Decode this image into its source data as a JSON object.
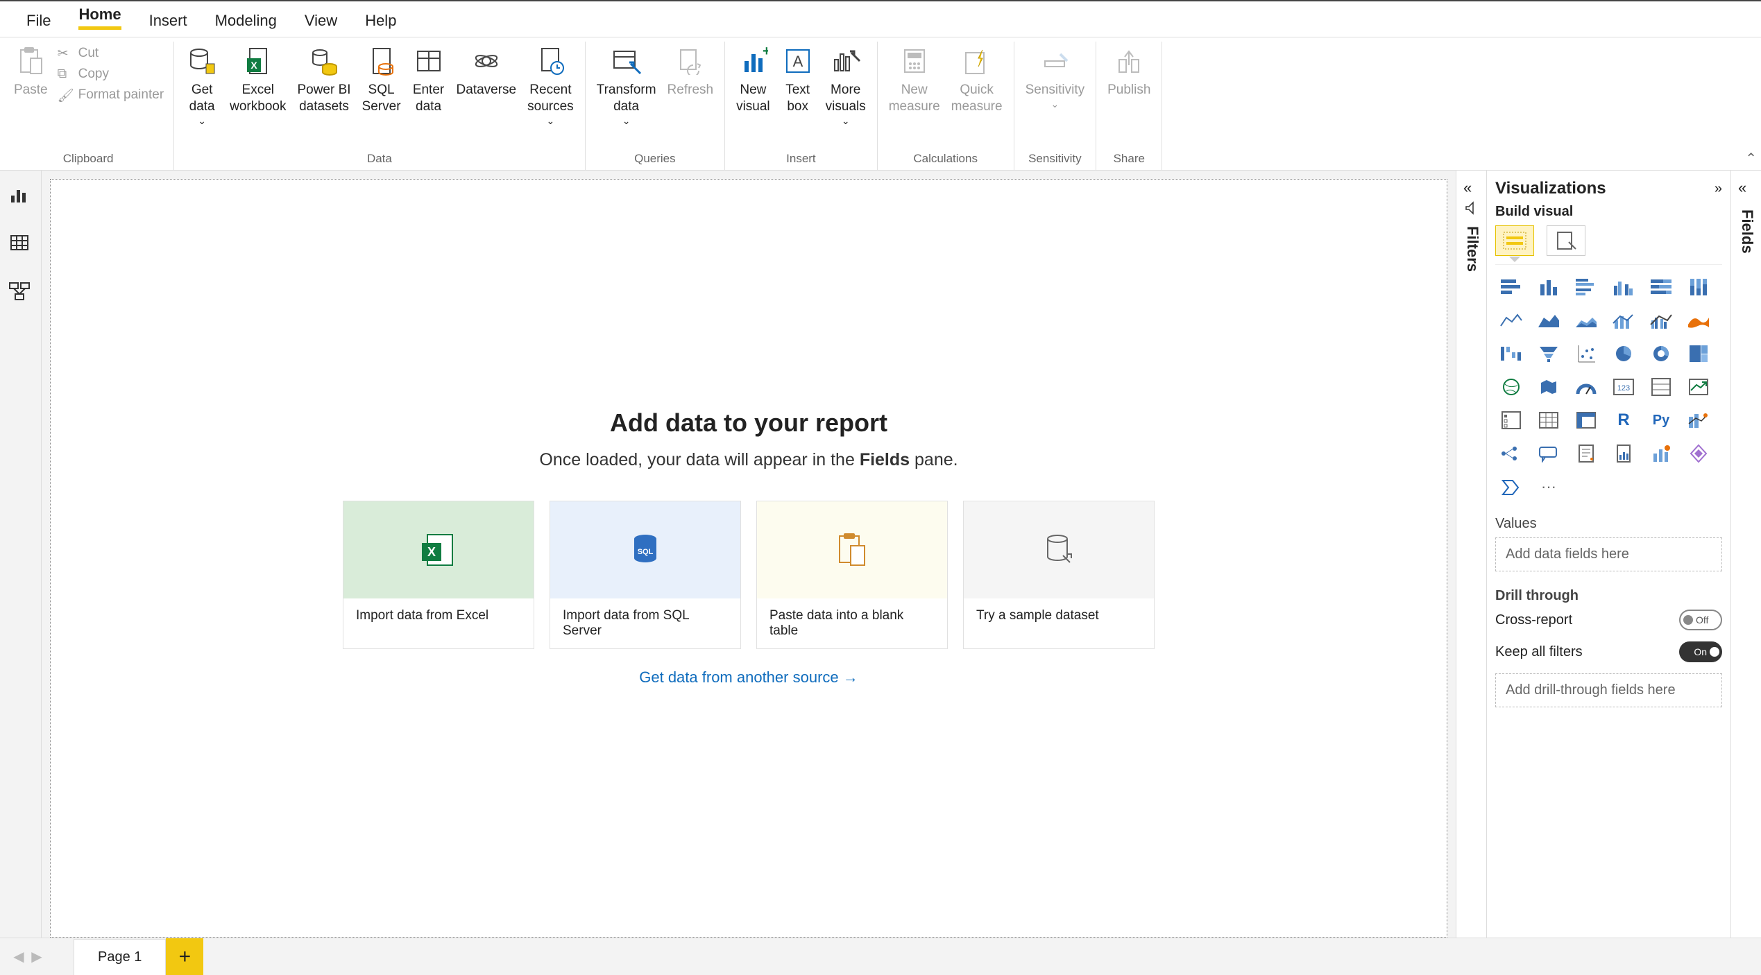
{
  "menu": {
    "file": "File",
    "home": "Home",
    "insert": "Insert",
    "modeling": "Modeling",
    "view": "View",
    "help": "Help"
  },
  "clipboard": {
    "group": "Clipboard",
    "paste": "Paste",
    "cut": "Cut",
    "copy": "Copy",
    "format_painter": "Format painter"
  },
  "data_group": {
    "group": "Data",
    "get_data": "Get\ndata",
    "excel": "Excel\nworkbook",
    "pbi": "Power BI\ndatasets",
    "sql": "SQL\nServer",
    "enter": "Enter\ndata",
    "dataverse": "Dataverse",
    "recent": "Recent\nsources"
  },
  "queries": {
    "group": "Queries",
    "transform": "Transform\ndata",
    "refresh": "Refresh"
  },
  "insert_group": {
    "group": "Insert",
    "new_visual": "New\nvisual",
    "text_box": "Text\nbox",
    "more": "More\nvisuals"
  },
  "calc": {
    "group": "Calculations",
    "new_measure": "New\nmeasure",
    "quick": "Quick\nmeasure"
  },
  "sensitivity": {
    "group": "Sensitivity",
    "label": "Sensitivity"
  },
  "share": {
    "group": "Share",
    "publish": "Publish"
  },
  "canvas": {
    "title": "Add data to your report",
    "subtitle_a": "Once loaded, your data will appear in the ",
    "subtitle_b": "Fields",
    "subtitle_c": " pane.",
    "cards": {
      "excel": "Import data from Excel",
      "sql": "Import data from SQL Server",
      "paste": "Paste data into a blank table",
      "sample": "Try a sample dataset"
    },
    "another": "Get data from another source →"
  },
  "filters_label": "Filters",
  "viz": {
    "title": "Visualizations",
    "build": "Build visual",
    "values": "Values",
    "values_placeholder": "Add data fields here",
    "drill": "Drill through",
    "cross": "Cross-report",
    "keep": "Keep all filters",
    "drill_placeholder": "Add drill-through fields here",
    "off": "Off",
    "on": "On"
  },
  "fields_label": "Fields",
  "pagebar": {
    "page1": "Page 1",
    "add": "+"
  }
}
